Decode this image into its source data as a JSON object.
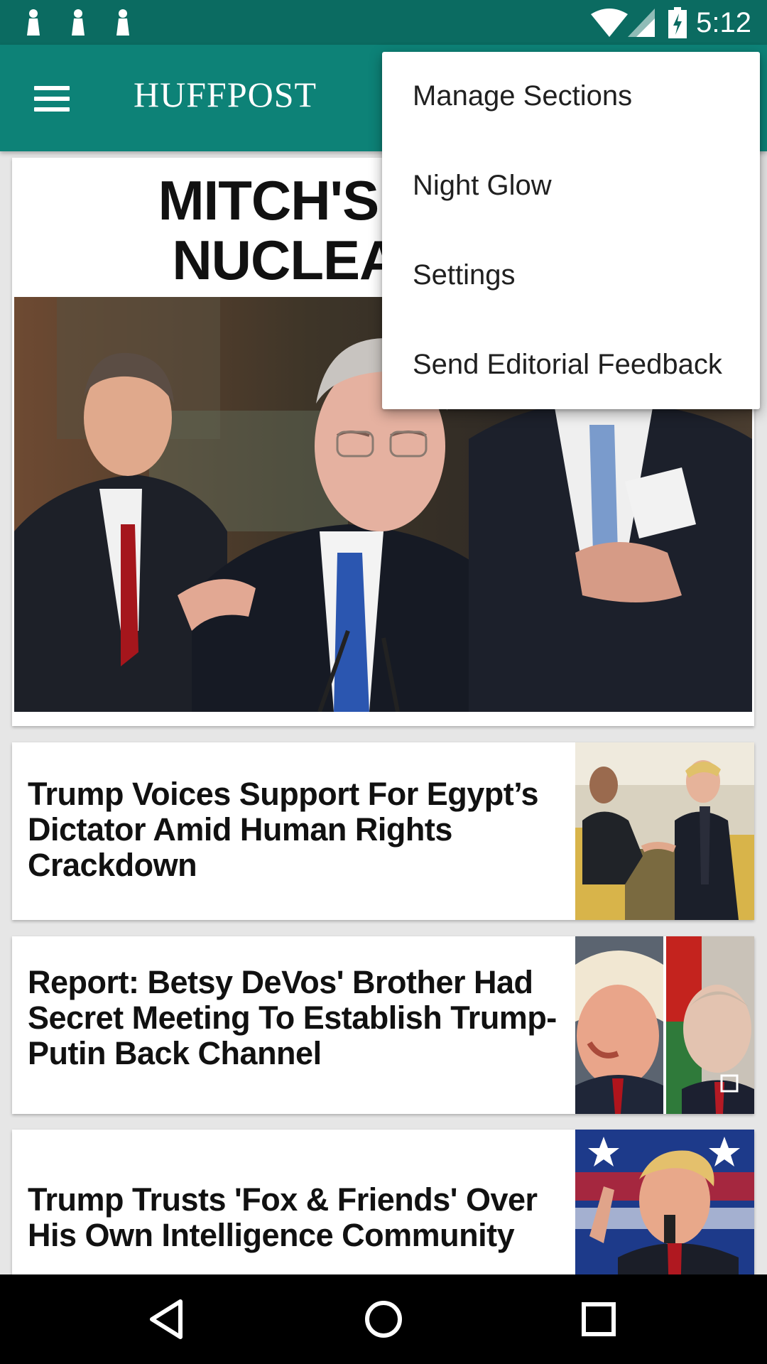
{
  "status_bar": {
    "time": "5:12",
    "notification_icons": [
      "notification-icon",
      "notification-icon",
      "notification-icon"
    ],
    "system_icons": [
      "wifi-icon",
      "cellular-signal-icon",
      "battery-charging-icon"
    ]
  },
  "app_bar": {
    "brand": "HUFFPOST",
    "menu_icon": "hamburger-menu-icon",
    "background_color": "#0d8277"
  },
  "overflow_menu": {
    "items": [
      {
        "label": "Manage Sections"
      },
      {
        "label": "Night Glow"
      },
      {
        "label": "Settings"
      },
      {
        "label": "Send Editorial Feedback"
      }
    ]
  },
  "hero": {
    "headline_line1": "MITCH'S FIN",
    "headline_line2": "NUCLEAR"
  },
  "stories": [
    {
      "title": "Trump Voices Support For Egypt’s Dictator Amid Human Rights Crackdown"
    },
    {
      "title": "Report: Betsy DeVos' Brother Had Secret Meeting To Establish Trump-Putin Back Channel"
    },
    {
      "title": "Trump Trusts 'Fox & Friends' Over His Own Intelligence Community"
    }
  ],
  "nav_bar": {
    "buttons": [
      "back-icon",
      "home-icon",
      "recents-icon"
    ]
  }
}
